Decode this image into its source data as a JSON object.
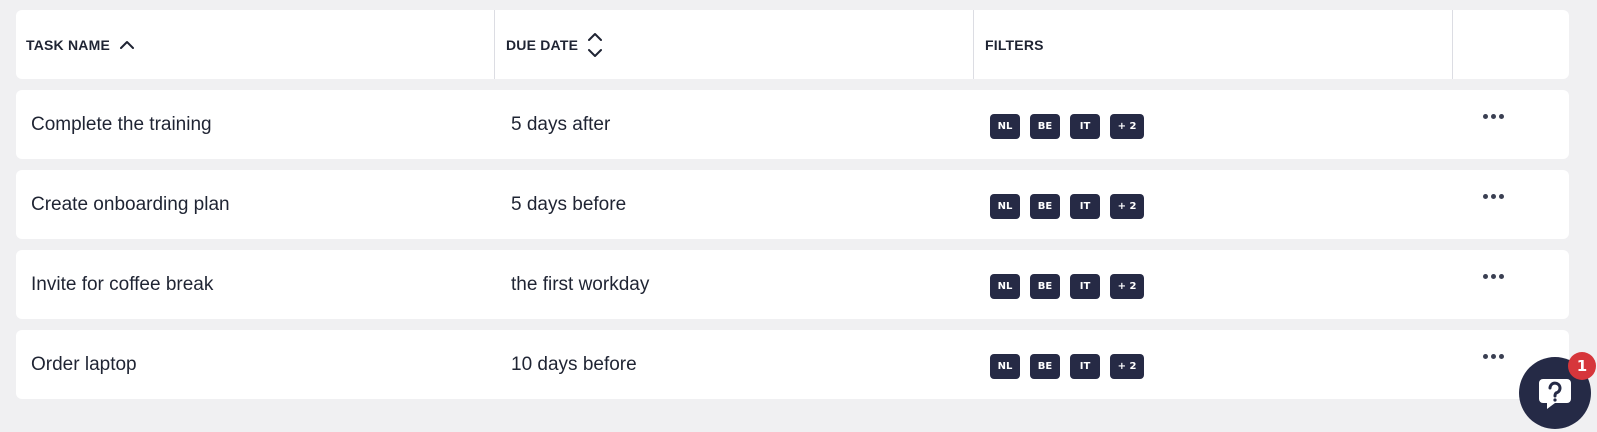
{
  "table": {
    "columns": {
      "task_name": "TASK NAME",
      "due_date": "DUE DATE",
      "filters": "FILTERS"
    },
    "rows": [
      {
        "task": "Complete the training",
        "due": "5 days after",
        "filters": [
          "NL",
          "BE",
          "IT",
          "+ 2"
        ]
      },
      {
        "task": "Create onboarding plan",
        "due": "5 days before",
        "filters": [
          "NL",
          "BE",
          "IT",
          "+ 2"
        ]
      },
      {
        "task": "Invite for coffee break",
        "due": "the first workday",
        "filters": [
          "NL",
          "BE",
          "IT",
          "+ 2"
        ]
      },
      {
        "task": "Order laptop",
        "due": "10 days before",
        "filters": [
          "NL",
          "BE",
          "IT",
          "+ 2"
        ]
      }
    ]
  },
  "help_widget": {
    "icon": "chat-help-icon",
    "notification_count": "1"
  },
  "colors": {
    "background": "#f0f0f2",
    "badge": "#262a45",
    "help_button": "#252a46",
    "notification": "#d6363b"
  }
}
